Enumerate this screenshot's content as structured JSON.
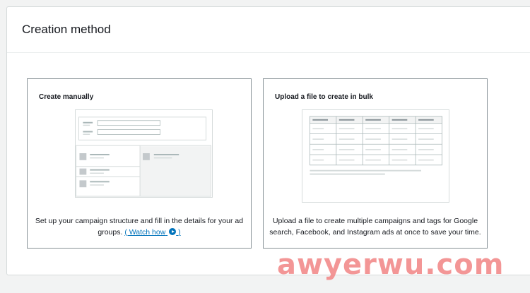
{
  "section": {
    "title": "Creation method"
  },
  "cards": {
    "manual": {
      "title": "Create manually",
      "description": "Set up your campaign structure and fill in the details for your ad groups.",
      "watch_link": "( Watch how",
      "watch_link_end": ")"
    },
    "bulk": {
      "title": "Upload a file to create in bulk",
      "description": "Upload a file to create multiple campaigns and tags for Google search, Facebook, and Instagram ads at once to save your time."
    }
  },
  "watermark": "awyerwu.com",
  "colors": {
    "link": "#0073bb",
    "border": "#879196",
    "watermark": "#f28b8b"
  },
  "icons": {
    "watch": "play-circle-icon"
  }
}
